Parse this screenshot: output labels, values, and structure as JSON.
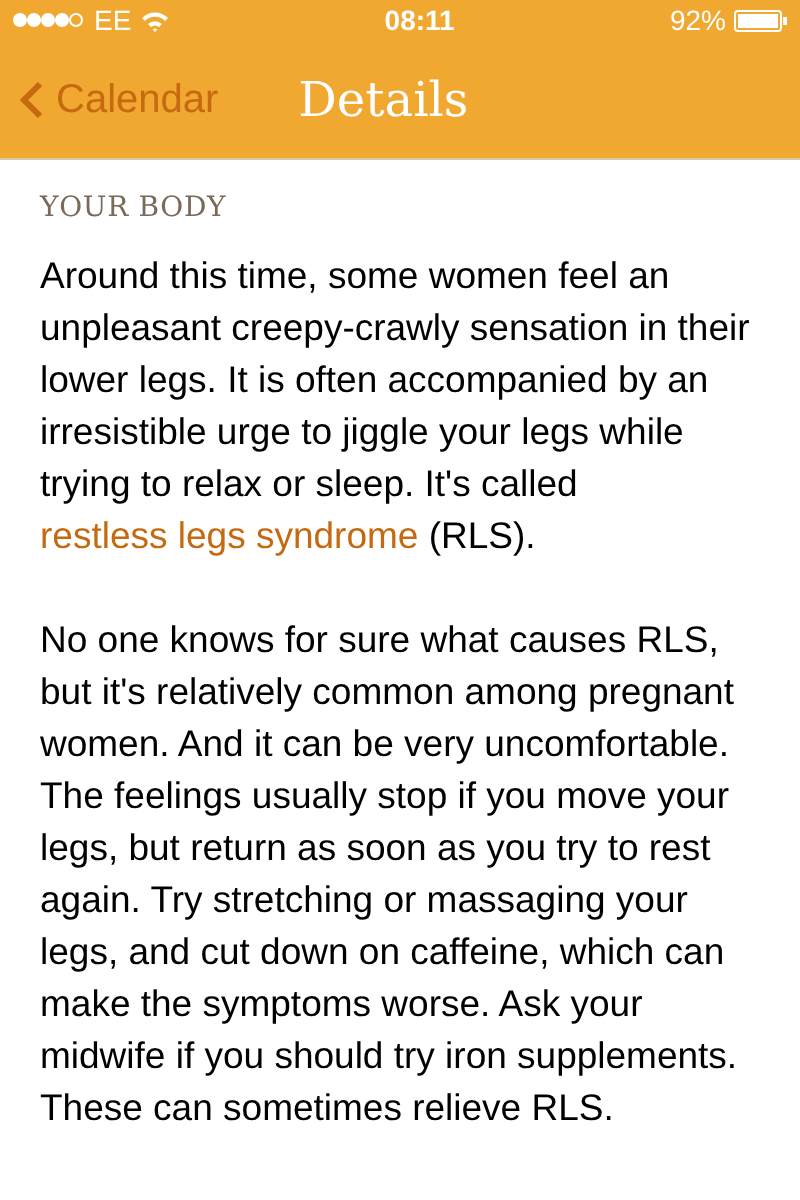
{
  "status_bar": {
    "carrier": "EE",
    "time": "08:11",
    "battery": "92%"
  },
  "nav": {
    "back": "Calendar",
    "title": "Details"
  },
  "section": "YOUR BODY",
  "paragraphs": [
    {
      "parts": [
        {
          "kind": "text",
          "text": "Around this time, some women feel an unpleasant creepy-crawly sensation in their lower legs. It is often accompanied by an irresistible urge to jiggle your legs while trying to relax or sleep. It's called "
        },
        {
          "kind": "link",
          "text": "restless legs syndrome"
        },
        {
          "kind": "text",
          "text": " (RLS)."
        }
      ]
    },
    {
      "parts": [
        {
          "kind": "text",
          "text": "No one knows for sure what causes RLS, but it's relatively common among pregnant women. And it can be very uncomfortable. The feelings usually stop if you move your legs, but return as soon as you try to rest again. Try stretching or massaging your legs, and cut down on caffeine, which can make the symptoms worse. Ask your midwife if you should try iron supplements. These can sometimes relieve RLS."
        }
      ]
    }
  ]
}
